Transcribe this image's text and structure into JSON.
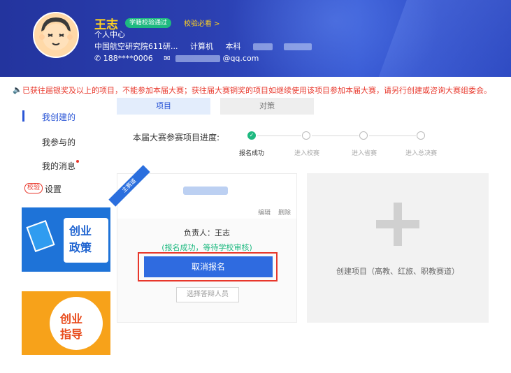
{
  "user": {
    "name": "王志",
    "verify_badge": "学籍校验通过",
    "verify_link": "校验必看 >",
    "center": "个人中心",
    "school": "中国航空研究院611研...",
    "major": "计算机",
    "degree": "本科",
    "phone": "188****0006",
    "email_suffix": "@qq.com"
  },
  "notice": "已获往届银奖及以上的项目，不能参加本届大赛；获往届大赛铜奖的项目如继续使用该项目参加本届大赛，请另行创建或咨询大赛组委会。",
  "sidebar": {
    "items": [
      {
        "label": "我创建的"
      },
      {
        "label": "我参与的"
      },
      {
        "label": "我的消息"
      }
    ],
    "verify_tag": "校验",
    "settings": "设置",
    "banner1": [
      "创业",
      "政策"
    ],
    "banner2": [
      "创业",
      "指导"
    ]
  },
  "tabs": [
    "项目",
    "对策"
  ],
  "progress": {
    "label": "本届大赛参赛项目进度:",
    "steps": [
      "报名成功",
      "进入校赛",
      "进入省赛",
      "进入总决赛"
    ],
    "completed": 1
  },
  "project_card": {
    "ribbon": "主赛道",
    "edit": "编辑",
    "delete": "删除",
    "leader": "负责人：王志",
    "status": "(报名成功，等待学校审核)",
    "cancel": "取消报名",
    "defense": "选择答辩人员"
  },
  "create_card": {
    "text": "创建项目（高教、红旅、职教赛道）"
  },
  "colors": {
    "header": "#2b3fb0",
    "accent": "#2f6be0",
    "success": "#1eb980",
    "warning": "#e8372b",
    "name": "#ffd21f"
  }
}
